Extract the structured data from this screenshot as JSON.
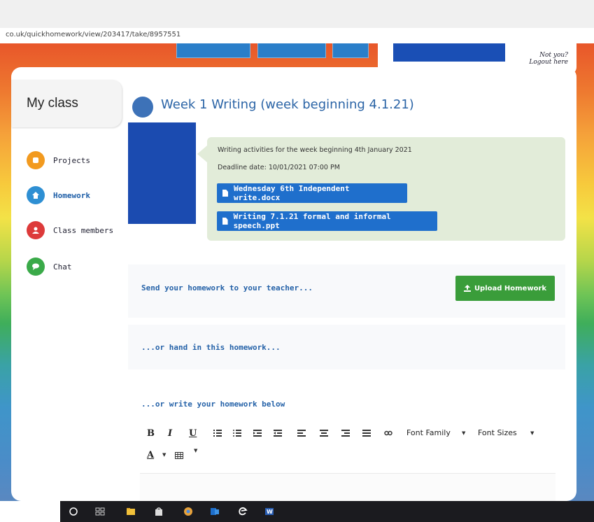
{
  "browser": {
    "url": "co.uk/quickhomework/view/203417/take/8957551"
  },
  "header": {
    "not_you": "Not you?",
    "logout": "Logout here"
  },
  "sidebar": {
    "title": "My class",
    "items": [
      {
        "label": "Projects",
        "icon": "projects-icon",
        "color": "#f29a1f"
      },
      {
        "label": "Homework",
        "icon": "homework-icon",
        "color": "#2e8fd3"
      },
      {
        "label": "Class members",
        "icon": "class-members-icon",
        "color": "#dd3a3a"
      },
      {
        "label": "Chat",
        "icon": "chat-icon",
        "color": "#3aaa49"
      }
    ]
  },
  "main": {
    "title": "Week 1 Writing (week beginning 4.1.21)",
    "description": "Writing activities for the week beginning 4th January 2021",
    "deadline": "Deadline date: 10/01/2021 07:00 PM",
    "files": [
      "Wednesday 6th Independent write.docx",
      "Writing 7.1.21 formal and informal speech.ppt"
    ],
    "send_prompt": "Send your homework to your teacher...",
    "upload_label": "Upload Homework",
    "hand_in_prompt": "...or hand in this homework...",
    "write_prompt": "...or write your homework below"
  },
  "editor": {
    "bold": "B",
    "italic": "I",
    "underline": "U",
    "font_family": "Font Family",
    "font_sizes": "Font Sizes",
    "font_color": "A"
  },
  "colors": {
    "accent": "#1f6fcc",
    "upload": "#3a9d3a",
    "title": "#2b64a6"
  }
}
